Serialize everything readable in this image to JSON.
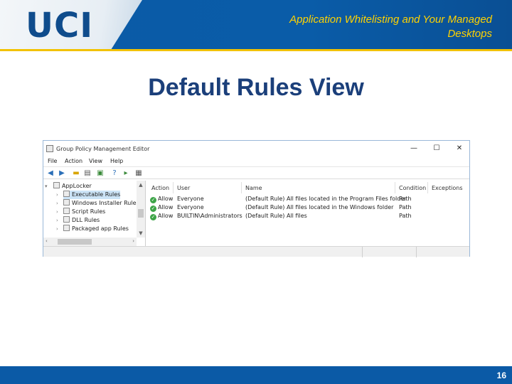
{
  "slide": {
    "logo_text": "UCI",
    "header_title": "Application Whitelisting and Your Managed Desktops",
    "title": "Default Rules View",
    "page_number": "16",
    "colors": {
      "brand_blue": "#0b5aa6",
      "gold": "#ffd200",
      "title_blue": "#1b3f7a"
    }
  },
  "window": {
    "title": "Group Policy Management Editor",
    "controls": {
      "minimize": "—",
      "maximize": "☐",
      "close": "✕"
    },
    "menu": [
      "File",
      "Action",
      "View",
      "Help"
    ],
    "toolbar_icons": [
      "back-arrow-icon",
      "forward-arrow-icon",
      "folder-icon",
      "properties-icon",
      "export-list-icon",
      "help-icon",
      "run-icon",
      "view-icon"
    ],
    "tree": [
      {
        "label": "AppLocker",
        "expanded": true
      },
      {
        "label": "Executable Rules",
        "selected": true
      },
      {
        "label": "Windows Installer Rules"
      },
      {
        "label": "Script Rules"
      },
      {
        "label": "DLL Rules"
      },
      {
        "label": "Packaged app Rules"
      }
    ],
    "columns": [
      "Action",
      "User",
      "Name",
      "Condition",
      "Exceptions"
    ],
    "rows": [
      {
        "action": "Allow",
        "user": "Everyone",
        "name": "(Default Rule) All files located in the Program Files folder",
        "condition": "Path",
        "exceptions": ""
      },
      {
        "action": "Allow",
        "user": "Everyone",
        "name": "(Default Rule) All files located in the Windows folder",
        "condition": "Path",
        "exceptions": ""
      },
      {
        "action": "Allow",
        "user": "BUILTIN\\Administrators",
        "name": "(Default Rule) All files",
        "condition": "Path",
        "exceptions": ""
      }
    ]
  }
}
